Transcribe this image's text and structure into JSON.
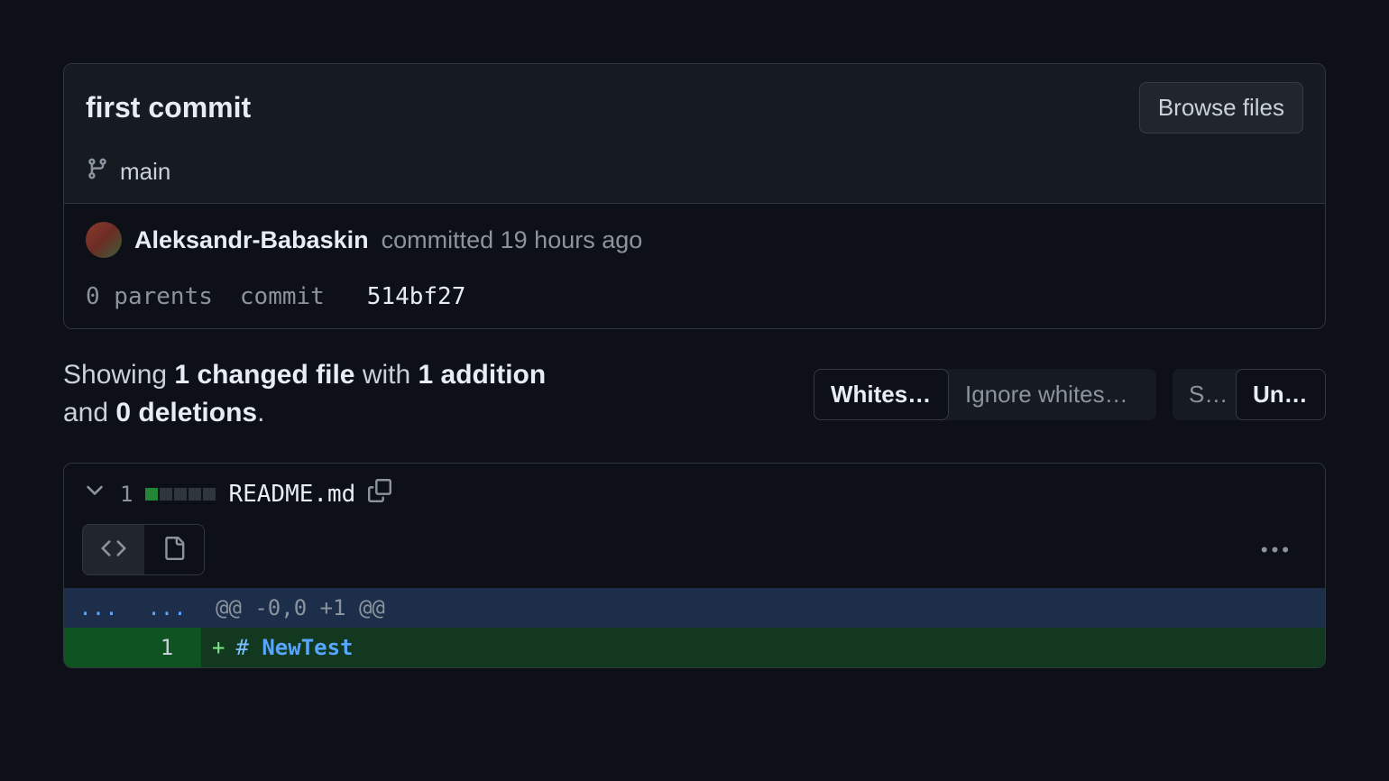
{
  "commit": {
    "title": "first commit",
    "browse_files_label": "Browse files",
    "branch": "main",
    "author": "Aleksandr-Babaskin",
    "action_text": "committed 19 hours ago",
    "parents_text": "0 parents",
    "commit_label": "commit",
    "sha": "514bf27"
  },
  "summary": {
    "prefix": "Showing ",
    "changed_files": "1 changed file",
    "mid1": " with ",
    "additions": "1 addition",
    "mid2": " and ",
    "deletions": "0 deletions",
    "suffix": "."
  },
  "toggles": {
    "whitespace": {
      "show": "Whitesp…",
      "ignore": "Ignore whitespa…"
    },
    "view": {
      "split": "Sp…",
      "unified": "Unifi…"
    }
  },
  "file": {
    "change_count": "1",
    "name": "README.md",
    "hunk_ellipsis_left": "...",
    "hunk_ellipsis_right": "...",
    "hunk_header": "@@ -0,0 +1 @@",
    "add_line_num": "1",
    "add_marker": "+",
    "code_hash": "#",
    "code_heading": "NewTest",
    "kebab": "•••"
  }
}
